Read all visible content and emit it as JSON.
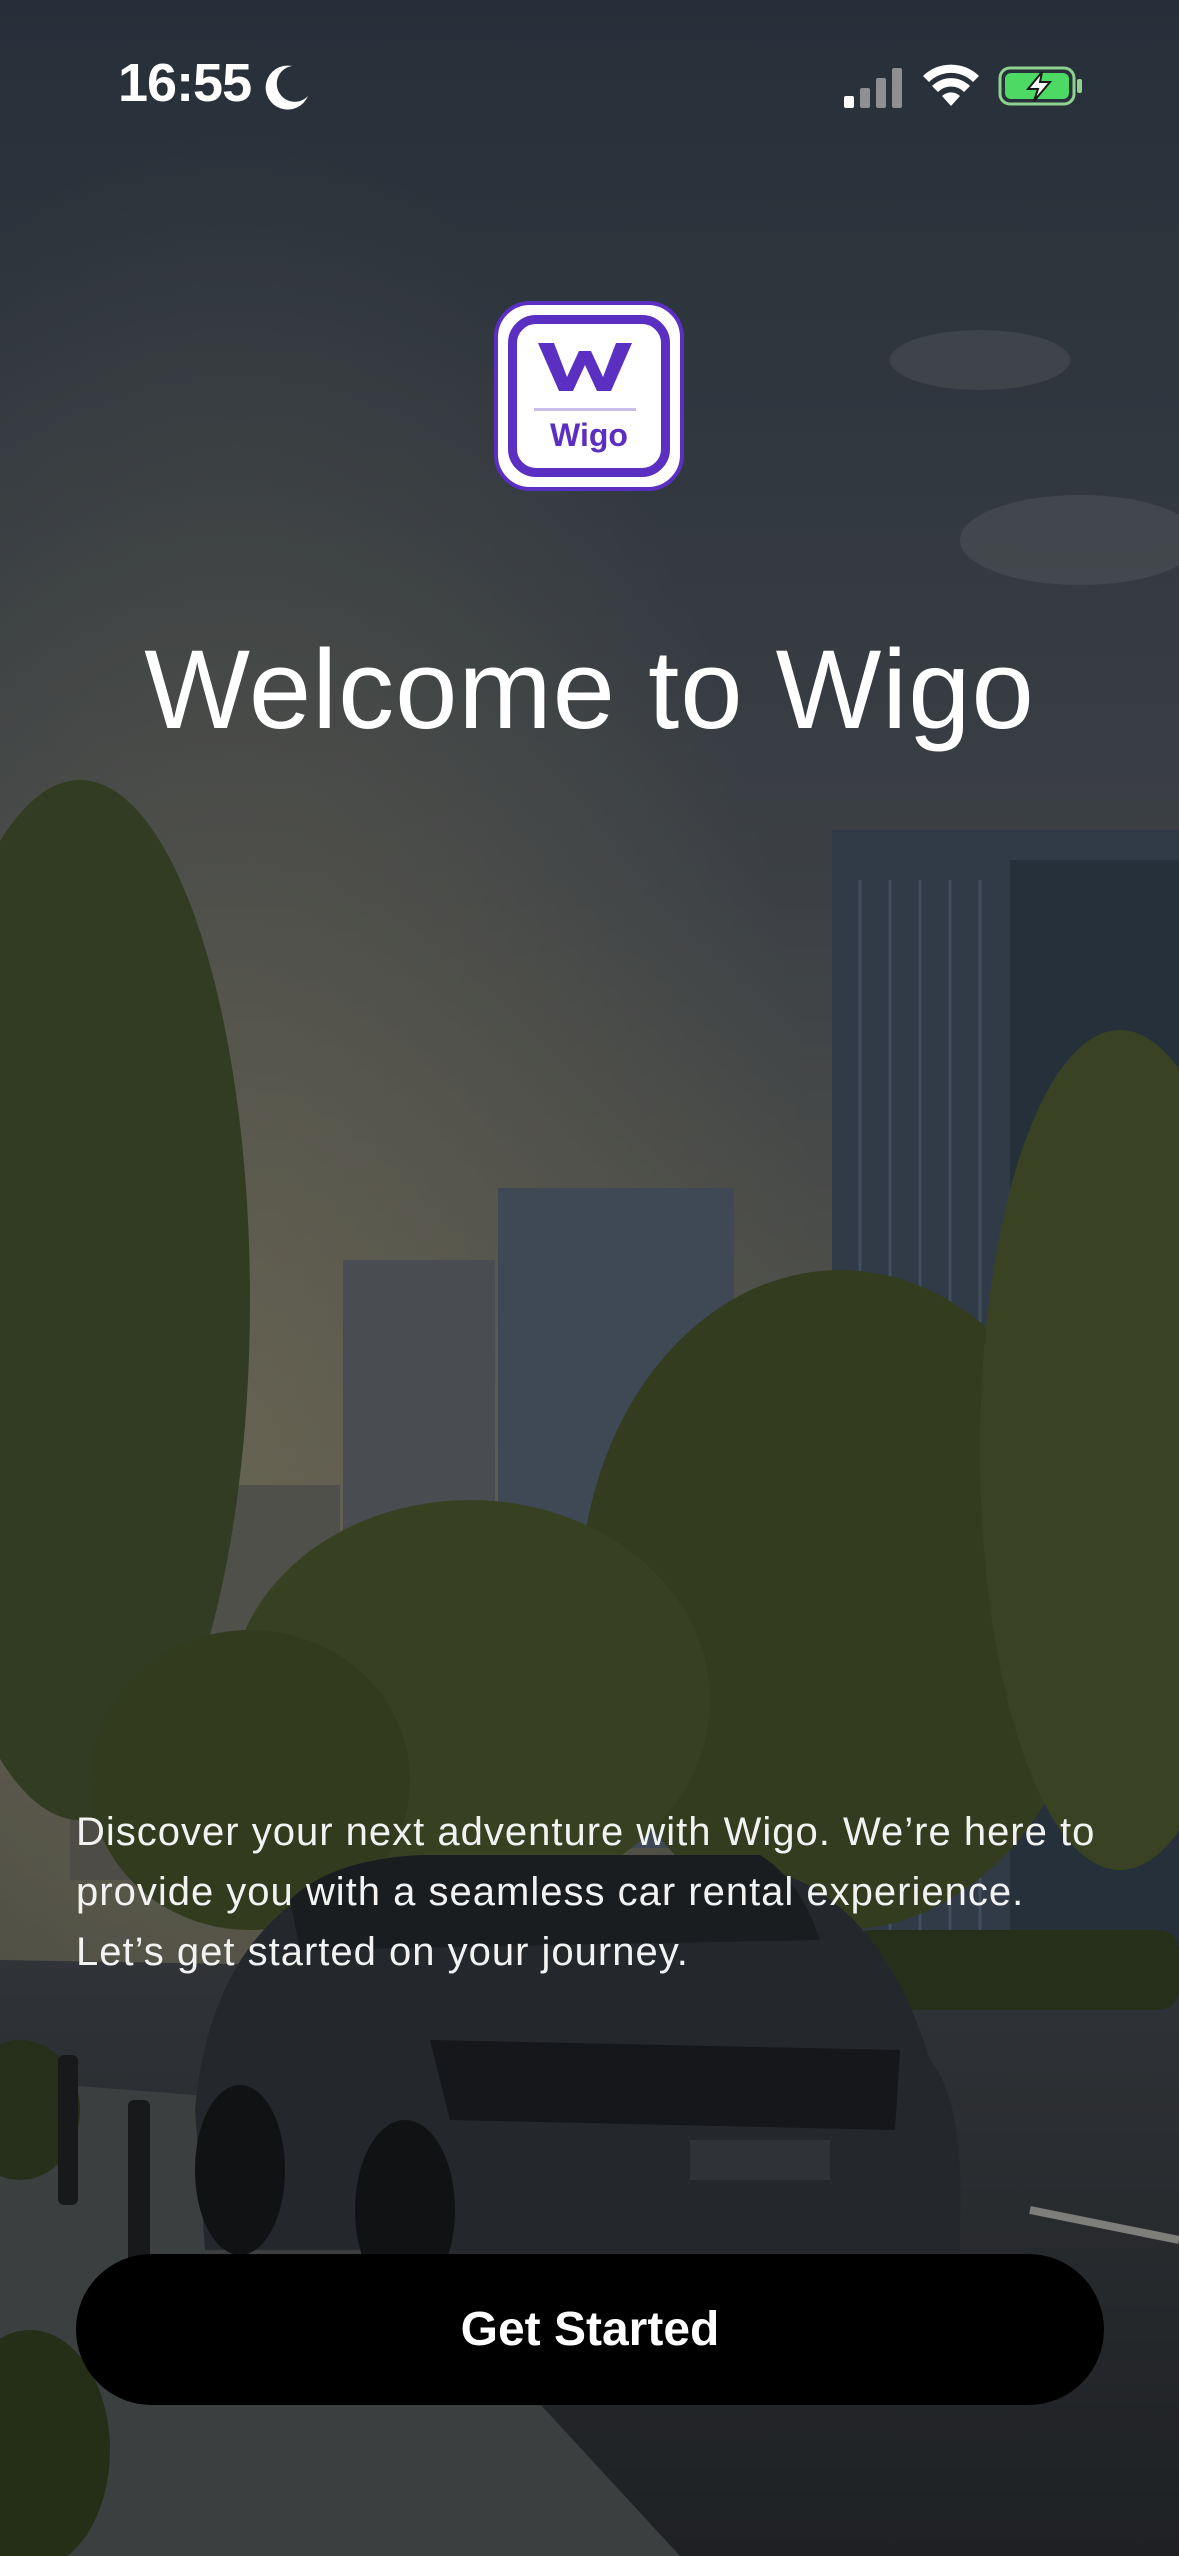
{
  "status_bar": {
    "time": "16:55",
    "icons": [
      "moon-icon",
      "cellular-signal-icon",
      "wifi-icon",
      "battery-charging-icon"
    ],
    "battery_color": "#4cd964"
  },
  "logo": {
    "monogram": "W",
    "name": "Wigo",
    "brand_color": "#5b2fc2"
  },
  "welcome": {
    "title": "Welcome to Wigo",
    "intro_line_1": "Discover your next adventure with Wigo. We’re here to provide you with a seamless car rental experience.",
    "intro_line_2": "Let’s get started on your journey."
  },
  "cta": {
    "label": "Get Started"
  }
}
